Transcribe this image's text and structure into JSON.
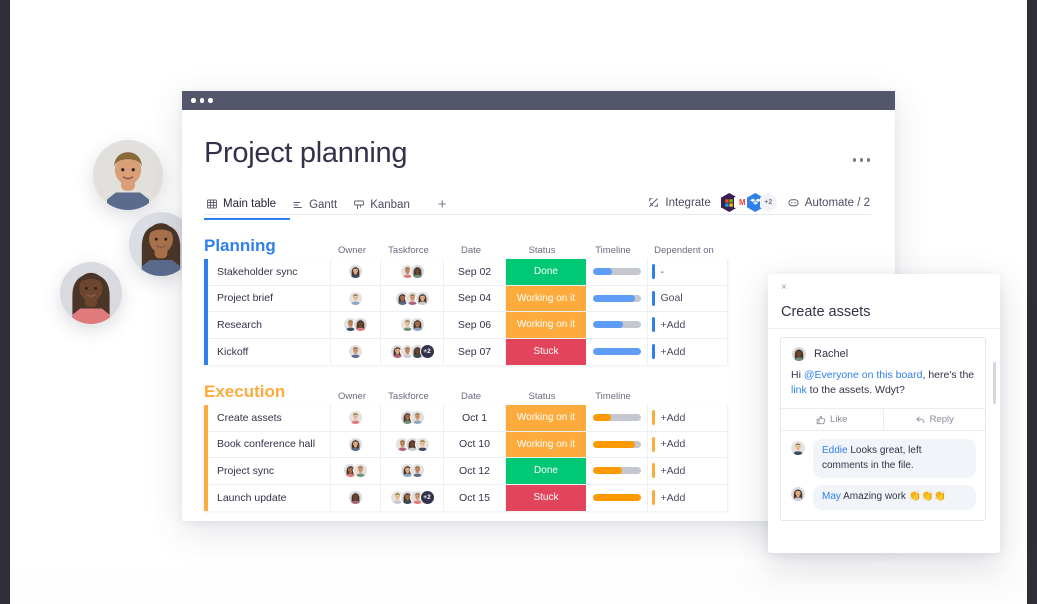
{
  "window": {
    "dots": 3
  },
  "board": {
    "title": "Project planning",
    "kebab_label": "more-options"
  },
  "tabs": [
    {
      "label": "Main table",
      "icon": "table-icon",
      "active": true
    },
    {
      "label": "Gantt",
      "icon": "gantt-icon",
      "active": false
    },
    {
      "label": "Kanban",
      "icon": "kanban-icon",
      "active": false
    }
  ],
  "tab_add_label": "+",
  "toolbar": {
    "integrate_label": "Integrate",
    "integrate_icon": "integrate-icon",
    "automate_label": "Automate / 2",
    "automate_icon": "robot-icon",
    "integration_badges": [
      {
        "name": "slack-badge",
        "glyph": "",
        "color": "#3b1f52"
      },
      {
        "name": "gmail-badge",
        "glyph": "M",
        "color": "#ffffff",
        "text_color": "#ea4335"
      },
      {
        "name": "dropbox-badge",
        "glyph": "",
        "color": "#2f80ed"
      },
      {
        "name": "more-badge",
        "glyph": "+2",
        "color": "#f1f3f8",
        "text_color": "#7a7a8c"
      }
    ]
  },
  "columns": [
    "Owner",
    "Taskforce",
    "Date",
    "Status",
    "Timeline",
    "Dependent on"
  ],
  "groups": [
    {
      "name": "Planning",
      "color": "#2f80ed",
      "show_dependent_header": true,
      "rows": [
        {
          "name": "Stakeholder sync",
          "date": "Sep 02",
          "status": "Done",
          "status_color": "#00c875",
          "timeline_pct": 40,
          "timeline_color": "#5e9cf5",
          "dependent": "-",
          "owner_faces": 1,
          "taskforce_faces": 2,
          "taskforce_extra": ""
        },
        {
          "name": "Project brief",
          "date": "Sep 04",
          "status": "Working on it",
          "status_color": "#fdab3d",
          "timeline_pct": 88,
          "timeline_color": "#5e9cf5",
          "dependent": "Goal",
          "owner_faces": 1,
          "taskforce_faces": 3,
          "taskforce_extra": ""
        },
        {
          "name": "Research",
          "date": "Sep 06",
          "status": "Working on it",
          "status_color": "#fdab3d",
          "timeline_pct": 64,
          "timeline_color": "#5e9cf5",
          "dependent": "+Add",
          "owner_faces": 2,
          "taskforce_faces": 2,
          "taskforce_extra": ""
        },
        {
          "name": "Kickoff",
          "date": "Sep 07",
          "status": "Stuck",
          "status_color": "#e2445c",
          "timeline_pct": 100,
          "timeline_color": "#5e9cf5",
          "dependent": "+Add",
          "owner_faces": 1,
          "taskforce_faces": 3,
          "taskforce_extra": "+2"
        }
      ]
    },
    {
      "name": "Execution",
      "color": "#fdab3d",
      "show_dependent_header": false,
      "rows": [
        {
          "name": "Create assets",
          "date": "Oct 1",
          "status": "Working on it",
          "status_color": "#fdab3d",
          "timeline_pct": 38,
          "timeline_color": "#ff9900",
          "dependent": "+Add",
          "owner_faces": 1,
          "taskforce_faces": 2,
          "taskforce_extra": ""
        },
        {
          "name": "Book conference hall",
          "date": "Oct 10",
          "status": "Working on it",
          "status_color": "#fdab3d",
          "timeline_pct": 88,
          "timeline_color": "#ff9900",
          "dependent": "+Add",
          "owner_faces": 1,
          "taskforce_faces": 3,
          "taskforce_extra": ""
        },
        {
          "name": "Project sync",
          "date": "Oct 12",
          "status": "Done",
          "status_color": "#00c875",
          "timeline_pct": 62,
          "timeline_color": "#ff9900",
          "dependent": "+Add",
          "owner_faces": 2,
          "taskforce_faces": 2,
          "taskforce_extra": ""
        },
        {
          "name": "Launch update",
          "date": "Oct 15",
          "status": "Stuck",
          "status_color": "#e2445c",
          "timeline_pct": 100,
          "timeline_color": "#ff9900",
          "dependent": "+Add",
          "owner_faces": 1,
          "taskforce_faces": 3,
          "taskforce_extra": "+2"
        }
      ]
    }
  ],
  "panel": {
    "close_label": "×",
    "title": "Create assets",
    "author": "Rachel",
    "message_prefix": "Hi ",
    "message_mention": "@Everyone on this board",
    "message_mid": ", here's the ",
    "message_link": "link",
    "message_suffix": " to the assets. Wdyt?",
    "like_label": "Like",
    "like_icon": "thumbs-up-icon",
    "reply_label": "Reply",
    "reply_icon": "reply-arrow-icon",
    "replies": [
      {
        "name": "Eddie",
        "text": " Looks great, left comments in the file."
      },
      {
        "name": "May",
        "text": " Amazing work 👏👏👏"
      }
    ]
  },
  "people": [
    {
      "name": "person-avatar-top"
    },
    {
      "name": "person-avatar-middle"
    },
    {
      "name": "person-avatar-bottom"
    }
  ],
  "colors": {
    "planning_accent": "#2f80ed",
    "execution_accent": "#fdab3d",
    "done": "#00c875",
    "working": "#fdab3d",
    "stuck": "#e2445c",
    "titlebar": "#54566b"
  }
}
